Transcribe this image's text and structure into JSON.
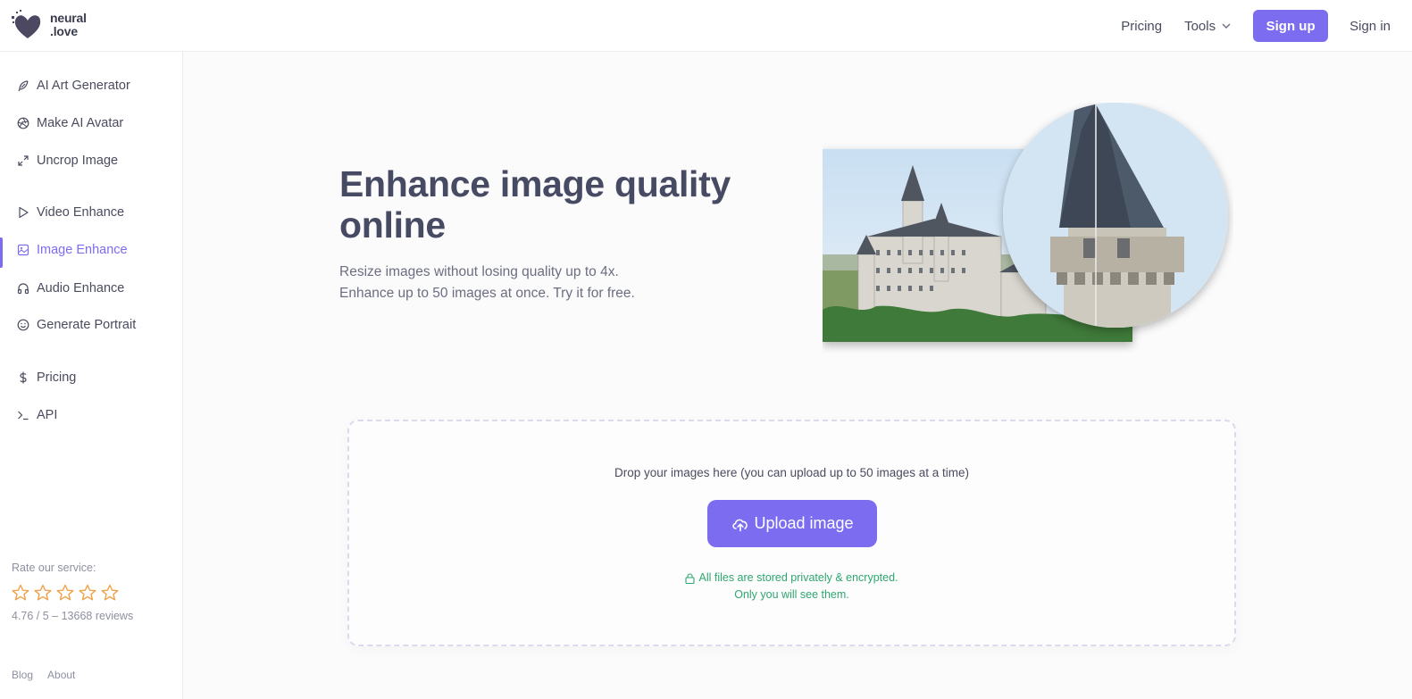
{
  "brand": {
    "line1": "neural",
    "line2": ".love"
  },
  "nav": {
    "pricing": "Pricing",
    "tools": "Tools",
    "signup": "Sign up",
    "signin": "Sign in"
  },
  "sidebar": {
    "items": [
      {
        "label": "AI Art Generator",
        "icon": "feather-icon"
      },
      {
        "label": "Make AI Avatar",
        "icon": "aperture-icon"
      },
      {
        "label": "Uncrop Image",
        "icon": "expand-icon"
      },
      {
        "label": "Video Enhance",
        "icon": "play-icon"
      },
      {
        "label": "Image Enhance",
        "icon": "image-icon",
        "active": true
      },
      {
        "label": "Audio Enhance",
        "icon": "headphones-icon"
      },
      {
        "label": "Generate Portrait",
        "icon": "smile-icon"
      },
      {
        "label": "Pricing",
        "icon": "dollar-icon"
      },
      {
        "label": "API",
        "icon": "terminal-icon"
      }
    ],
    "rate_label": "Rate our service:",
    "rating_text": "4.76 / 5 – 13668 reviews",
    "star_count": 5,
    "footer": {
      "blog": "Blog",
      "about": "About"
    }
  },
  "hero": {
    "title": "Enhance image quality online",
    "sub_line1": "Resize images without losing quality up to 4x.",
    "sub_line2": "Enhance up to 50 images at once. Try it for free."
  },
  "upload": {
    "drop_text": "Drop your images here (you can upload up to 50 images at a time)",
    "button": "Upload image",
    "privacy_line1": "All files are stored privately & encrypted.",
    "privacy_line2": "Only you will see them."
  },
  "colors": {
    "accent": "#7c6cf0",
    "privacy_green": "#2ea66f",
    "star": "#f0a24a"
  }
}
